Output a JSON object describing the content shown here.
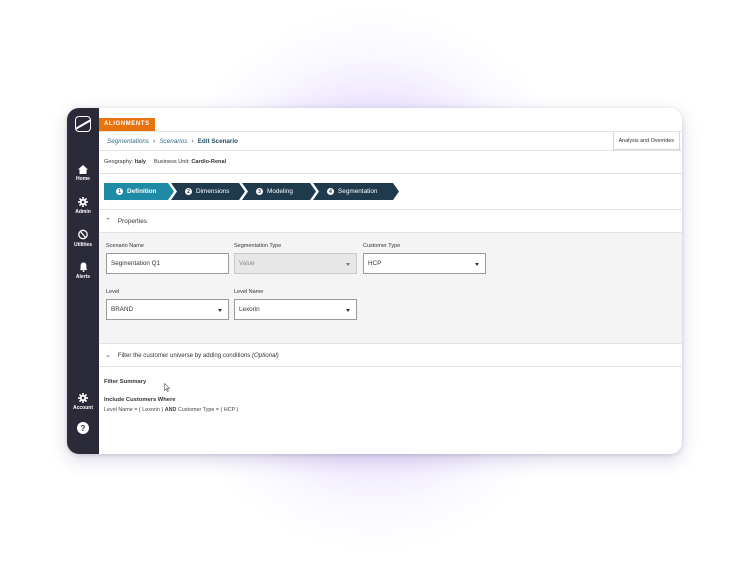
{
  "app": {
    "brand_tab": "ALIGNMENTS"
  },
  "sidebar": {
    "items": [
      {
        "label": "Home",
        "icon": "home-icon"
      },
      {
        "label": "Admin",
        "icon": "gear-icon"
      },
      {
        "label": "Utilities",
        "icon": "utilities-icon"
      },
      {
        "label": "Alerts",
        "icon": "bell-icon"
      }
    ],
    "account_label": "Account",
    "help_label": "?"
  },
  "breadcrumb": {
    "items": [
      "Segmentations",
      "Scenarios"
    ],
    "current": "Edit Scenario"
  },
  "toolbar": {
    "analysis_button": "Analysis and Overrides"
  },
  "context": {
    "geography_label": "Geography:",
    "geography_value": "Italy",
    "bu_label": "Business Unit:",
    "bu_value": "Cardio-Renal"
  },
  "steps": [
    {
      "num": "1",
      "label": "Definition",
      "active": true
    },
    {
      "num": "2",
      "label": "Dimensions",
      "active": false
    },
    {
      "num": "3",
      "label": "Modeling",
      "active": false
    },
    {
      "num": "4",
      "label": "Segmentation",
      "active": false
    }
  ],
  "properties": {
    "title": "Properties",
    "scenario_name": {
      "label": "Scenario Name",
      "value": "Segmentation Q1"
    },
    "segmentation_type": {
      "label": "Segmentation Type",
      "value": "Value"
    },
    "customer_type": {
      "label": "Customer Type",
      "value": "HCP"
    },
    "level": {
      "label": "Level",
      "value": "BRAND"
    },
    "level_name": {
      "label": "Level Name",
      "value": "Lexorin"
    }
  },
  "filter": {
    "title": "Filter the customer universe by adding conditions",
    "optional": "(Optional)",
    "summary_title": "Filter Summary",
    "include_label": "Include Customers Where",
    "expr_part1": "Level Name = ( Lexorin )",
    "expr_and": "AND",
    "expr_part2": "Customer Type = ( HCP )"
  },
  "colors": {
    "accent_orange": "#e8730c",
    "step_active": "#1d8aa6",
    "step_inactive": "#1f3a4d",
    "sidebar": "#2b2a39",
    "link": "#2b6f8a"
  }
}
